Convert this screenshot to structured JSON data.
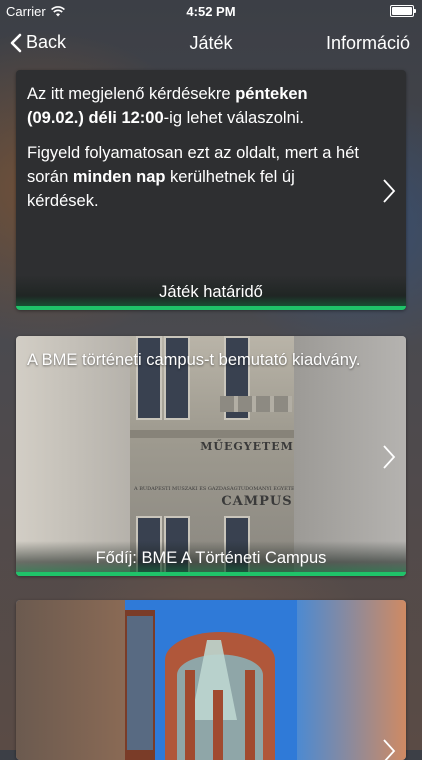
{
  "status_bar": {
    "carrier": "Carrier",
    "time": "4:52 PM"
  },
  "nav": {
    "back_label": "Back",
    "title": "Játék",
    "right_label": "Információ"
  },
  "cards": [
    {
      "paragraph1": {
        "t1": "Az itt megjelenő kérdésekre ",
        "b1": "pénteken (09.02.) déli 12:00",
        "t2": "-ig lehet válaszolni."
      },
      "paragraph2": {
        "t1": "Figyeld folyamatosan ezt az oldalt, mert a hét során ",
        "b1": "minden nap",
        "t2": " kerülhetnek fel új kérdések."
      },
      "footer": "Játék határidő"
    },
    {
      "text": "A BME történeti campus-t bemutató kiadvány.",
      "photo_sign": "MŰEGYETEM",
      "photo_subtitle": "A BUDAPESTI MŰSZAKI ÉS GAZDASÁGTUDOMÁNYI EGYETEM TÖRTÉNETI",
      "photo_word": "CAMPUS",
      "footer": "Fődíj: BME A Történeti Campus"
    },
    {}
  ],
  "colors": {
    "accent_green": "#1fc369"
  }
}
